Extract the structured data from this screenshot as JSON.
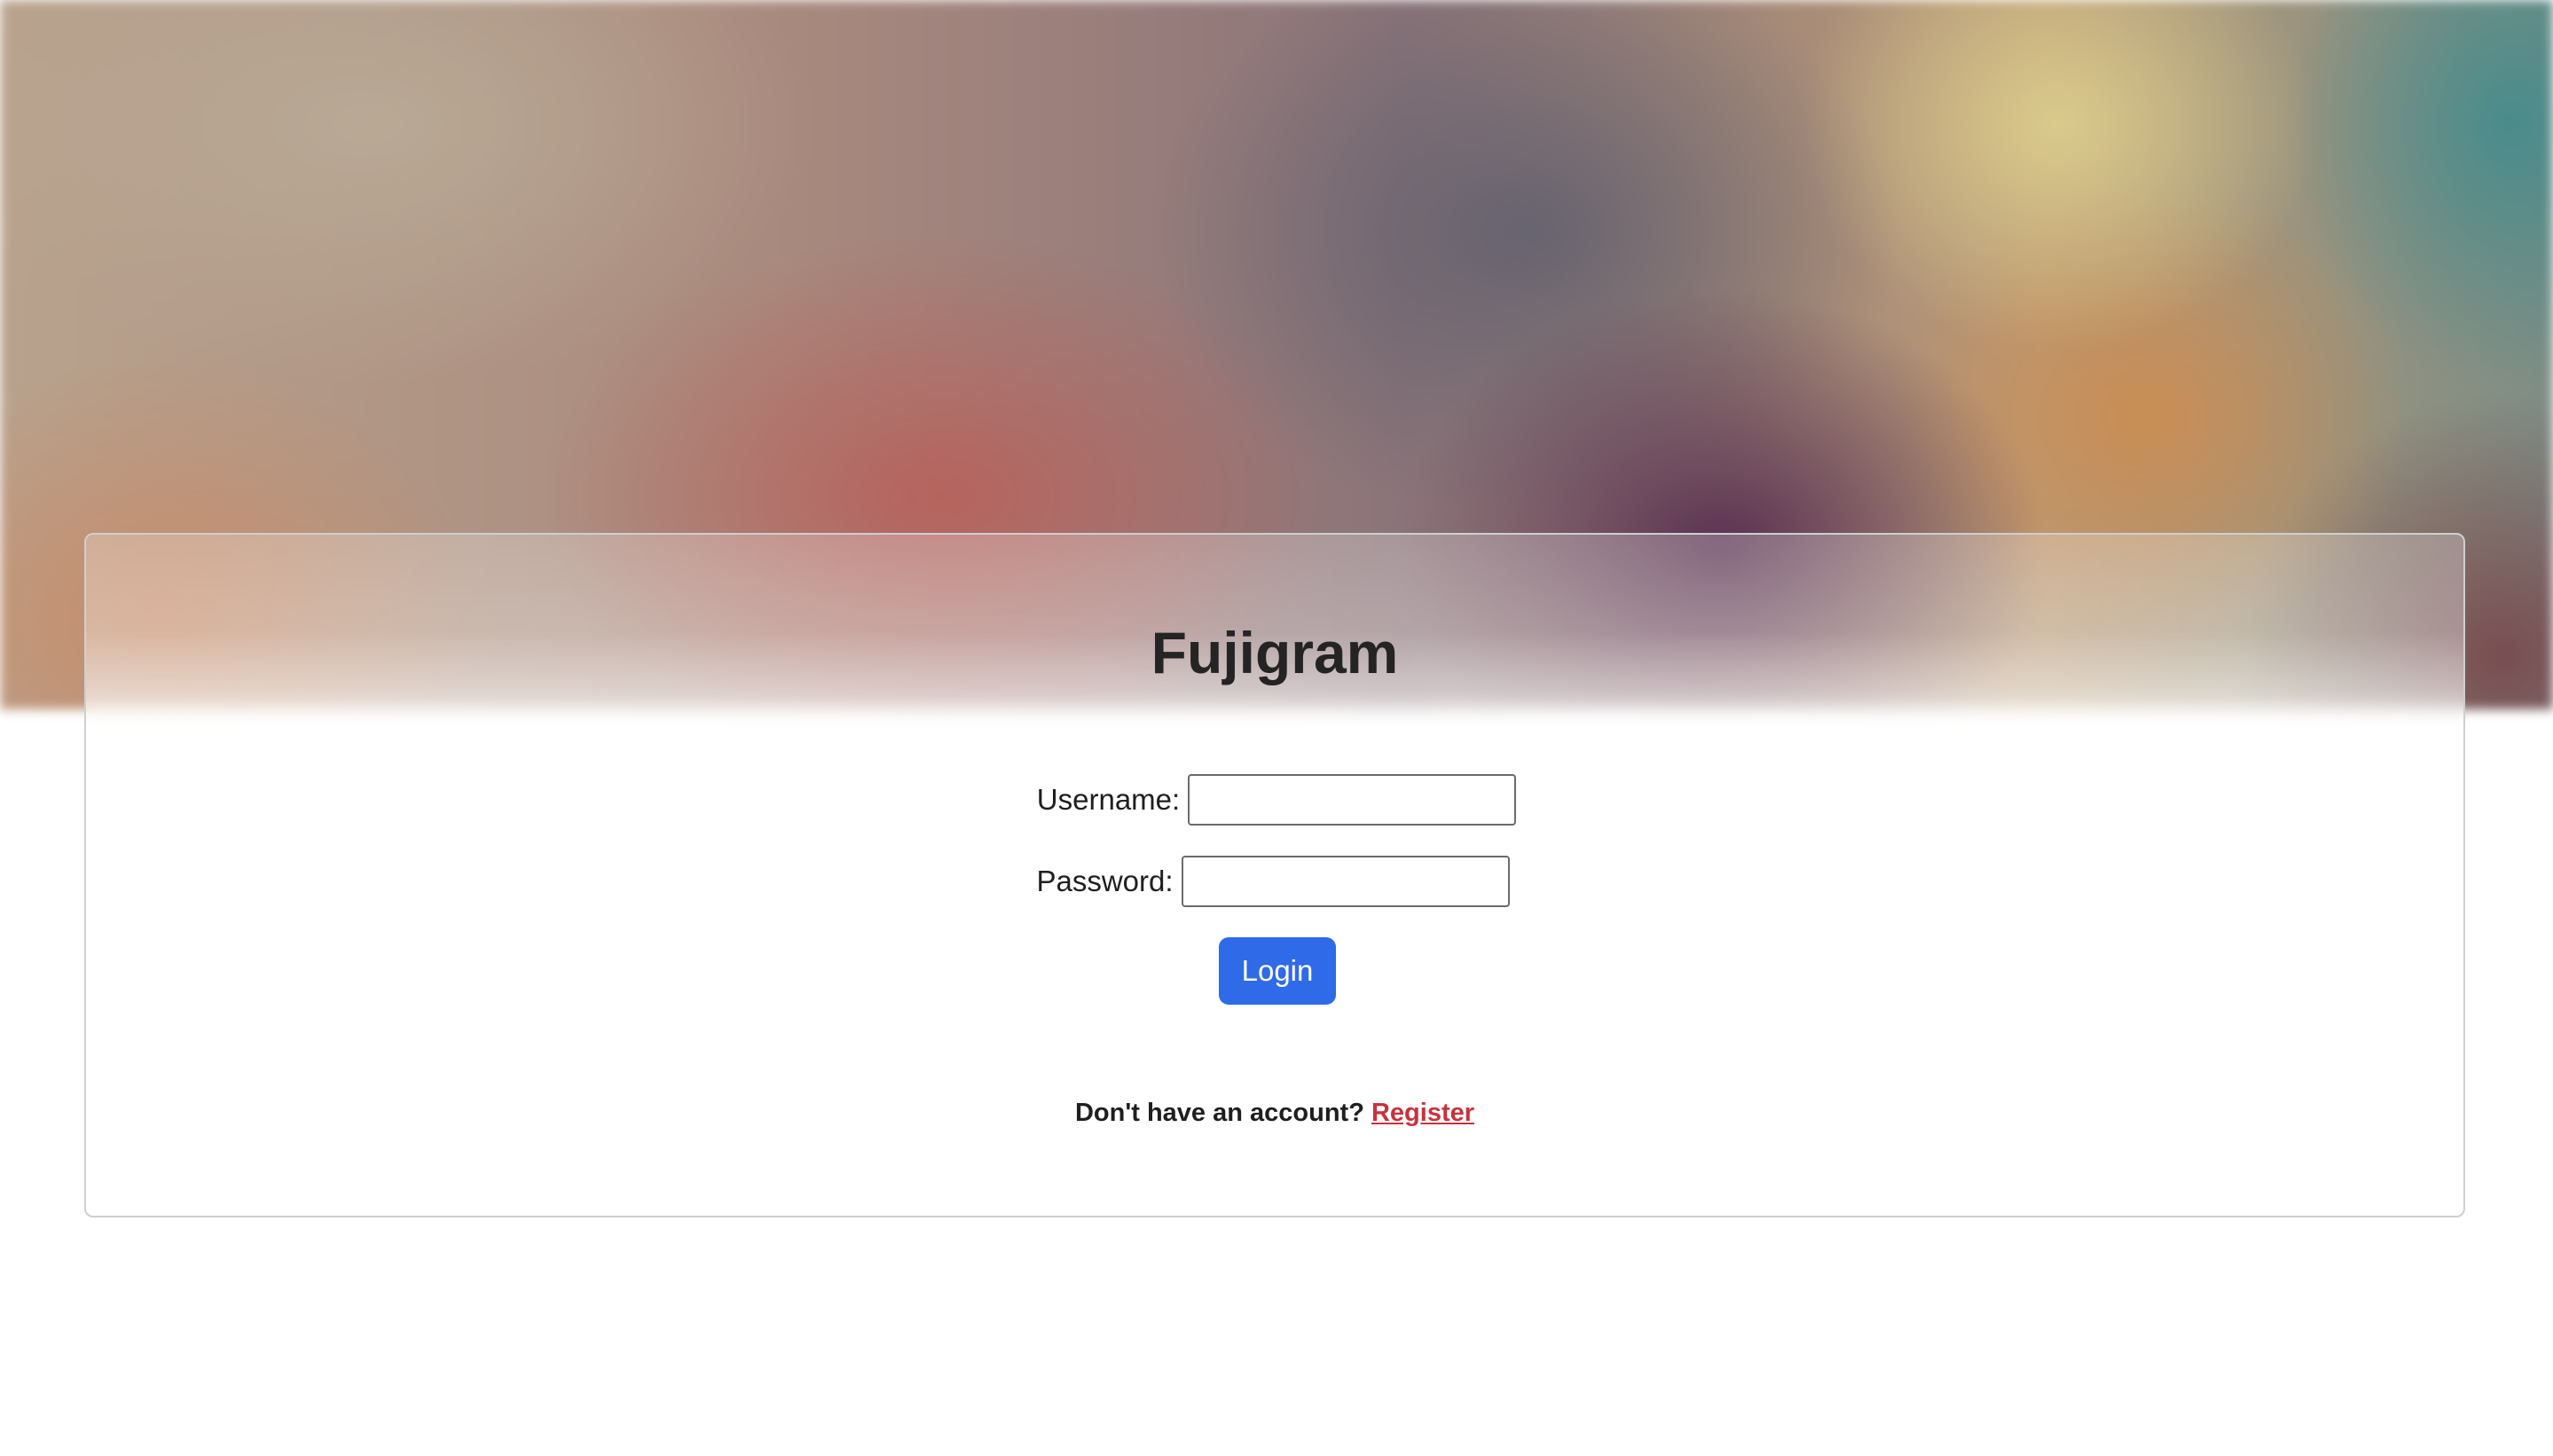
{
  "app": {
    "title": "Fujigram"
  },
  "form": {
    "username_label": "Username:",
    "username_value": "",
    "password_label": "Password:",
    "password_value": "",
    "login_label": "Login"
  },
  "footer": {
    "prompt": "Don't have an account?",
    "register_label": "Register"
  },
  "colors": {
    "login_button": "#2f6ae8",
    "register_link": "#c8323d",
    "title_text": "#242424"
  }
}
